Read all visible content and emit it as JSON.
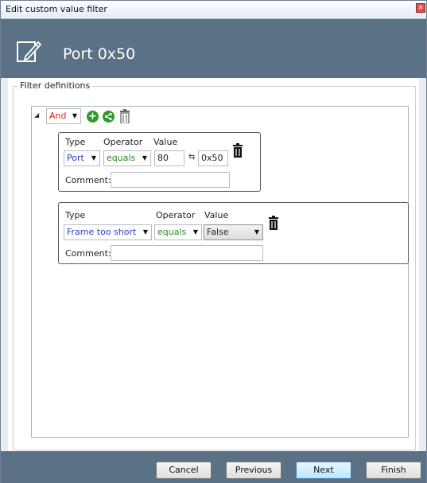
{
  "window": {
    "title": "Edit custom value filter",
    "close_glyph": "✕"
  },
  "header": {
    "title": "Port 0x50",
    "icon": "edit-pencil-icon"
  },
  "group": {
    "legend": "Filter definitions"
  },
  "root": {
    "logic_value": "And",
    "add_icon": "plus-circle-icon",
    "share_icon": "share-icon",
    "delete_icon": "trash-icon"
  },
  "conditions": [
    {
      "type_label": "Type",
      "operator_label": "Operator",
      "value_label": "Value",
      "type_value": "Port",
      "operator_value": "equals",
      "value_decimal": "80",
      "swap_glyph": "⇆",
      "value_hex": "0x50",
      "comment_label": "Comment:",
      "comment_value": ""
    },
    {
      "type_label": "Type",
      "operator_label": "Operator",
      "value_label": "Value",
      "type_value": "Frame too short",
      "operator_value": "equals",
      "value_select": "False",
      "comment_label": "Comment:",
      "comment_value": ""
    }
  ],
  "footer": {
    "cancel": "Cancel",
    "previous": "Previous",
    "next": "Next",
    "finish": "Finish"
  },
  "colors": {
    "header_bg": "#5a7186",
    "logic_red": "#d9261c",
    "type_blue": "#2a3bd0",
    "operator_green": "#2a8a1f",
    "icon_green": "#2a9b2a"
  }
}
